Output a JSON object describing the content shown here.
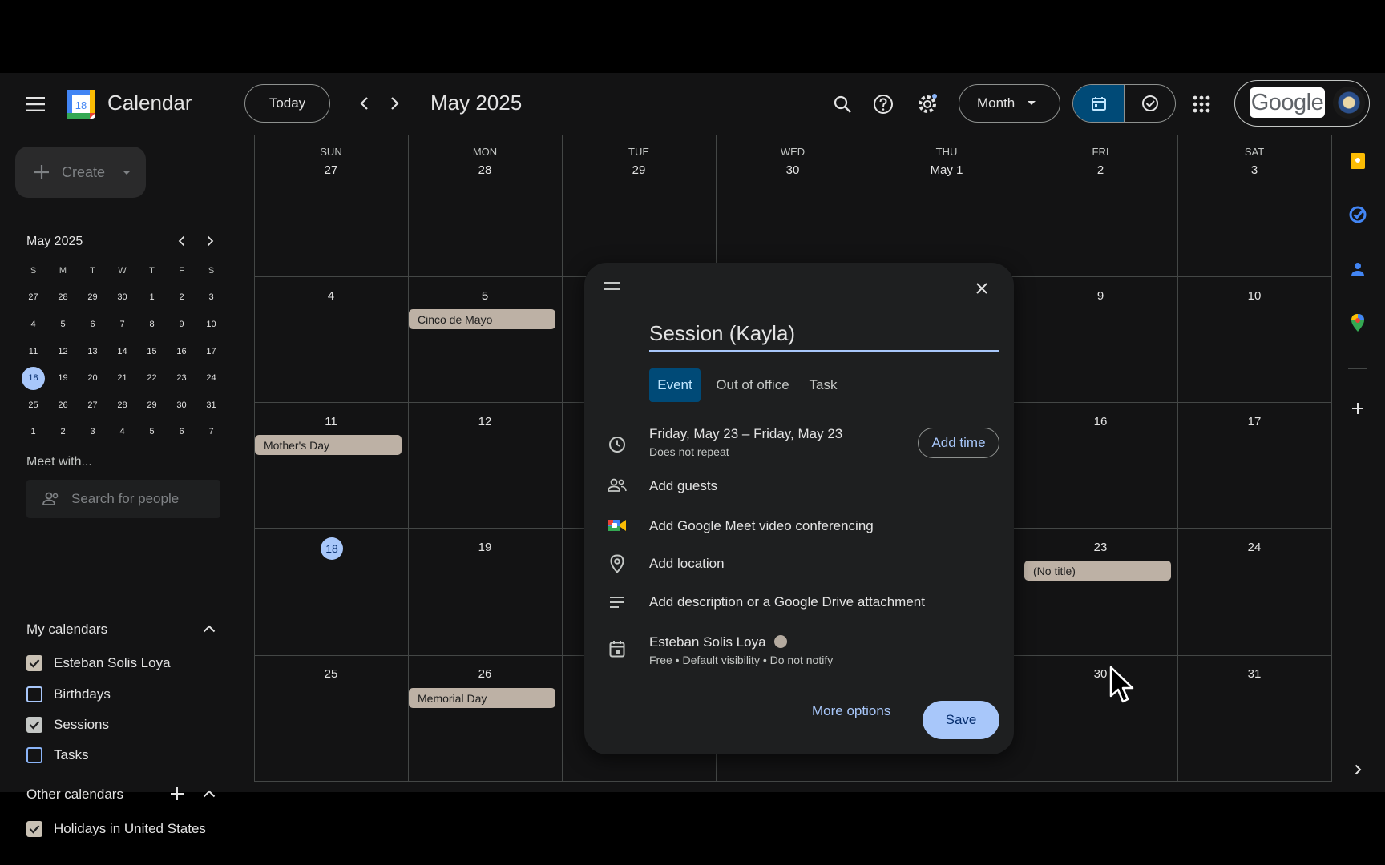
{
  "header": {
    "app_title": "Calendar",
    "logo_day": "18",
    "today_label": "Today",
    "month_title": "May 2025",
    "view_label": "Month",
    "google_label": "Google"
  },
  "sidebar": {
    "create_label": "Create",
    "mini_title": "May 2025",
    "weekday_initials": [
      "S",
      "M",
      "T",
      "W",
      "T",
      "F",
      "S"
    ],
    "mini_weeks": [
      [
        "27",
        "28",
        "29",
        "30",
        "1",
        "2",
        "3"
      ],
      [
        "4",
        "5",
        "6",
        "7",
        "8",
        "9",
        "10"
      ],
      [
        "11",
        "12",
        "13",
        "14",
        "15",
        "16",
        "17"
      ],
      [
        "18",
        "19",
        "20",
        "21",
        "22",
        "23",
        "24"
      ],
      [
        "25",
        "26",
        "27",
        "28",
        "29",
        "30",
        "31"
      ],
      [
        "1",
        "2",
        "3",
        "4",
        "5",
        "6",
        "7"
      ]
    ],
    "meet_with": "Meet with...",
    "search_people_placeholder": "Search for people",
    "my_calendars_title": "My calendars",
    "my_calendars": [
      {
        "label": "Esteban Solis Loya",
        "checked": true
      },
      {
        "label": "Birthdays",
        "checked": false
      },
      {
        "label": "Sessions",
        "checked": true
      },
      {
        "label": "Tasks",
        "checked": false
      }
    ],
    "other_calendars_title": "Other calendars",
    "other_calendars": [
      {
        "label": "Holidays in United States",
        "checked": true
      }
    ]
  },
  "grid": {
    "weekdays": [
      "SUN",
      "MON",
      "TUE",
      "WED",
      "THU",
      "FRI",
      "SAT"
    ],
    "weeks": [
      [
        "27",
        "28",
        "29",
        "30",
        "May 1",
        "2",
        "3"
      ],
      [
        "4",
        "5",
        "",
        "",
        "",
        "9",
        "10"
      ],
      [
        "11",
        "12",
        "",
        "",
        "",
        "16",
        "17"
      ],
      [
        "18",
        "19",
        "",
        "",
        "",
        "23",
        "24"
      ],
      [
        "25",
        "26",
        "",
        "",
        "",
        "30",
        "31"
      ]
    ],
    "events": {
      "cinco": "Cinco de Mayo",
      "mothers": "Mother's Day",
      "no_title": "(No title)",
      "memorial": "Memorial Day"
    }
  },
  "dialog": {
    "title_value": "Session (Kayla)",
    "tabs": [
      "Event",
      "Out of office",
      "Task"
    ],
    "date_range": "Friday, May 23   –   Friday, May 23",
    "repeat": "Does not repeat",
    "add_time": "Add time",
    "add_guests": "Add guests",
    "add_meet": "Add Google Meet video conferencing",
    "add_location": "Add location",
    "add_description": "Add description or a Google Drive attachment",
    "owner": "Esteban Solis Loya",
    "owner_details": "Free • Default visibility • Do not notify",
    "more_options": "More options",
    "save": "Save"
  },
  "colors": {
    "accent": "#a8c7fa",
    "event_chip": "#bdb1a5",
    "active_tab": "#004a77",
    "background": "#131314"
  }
}
